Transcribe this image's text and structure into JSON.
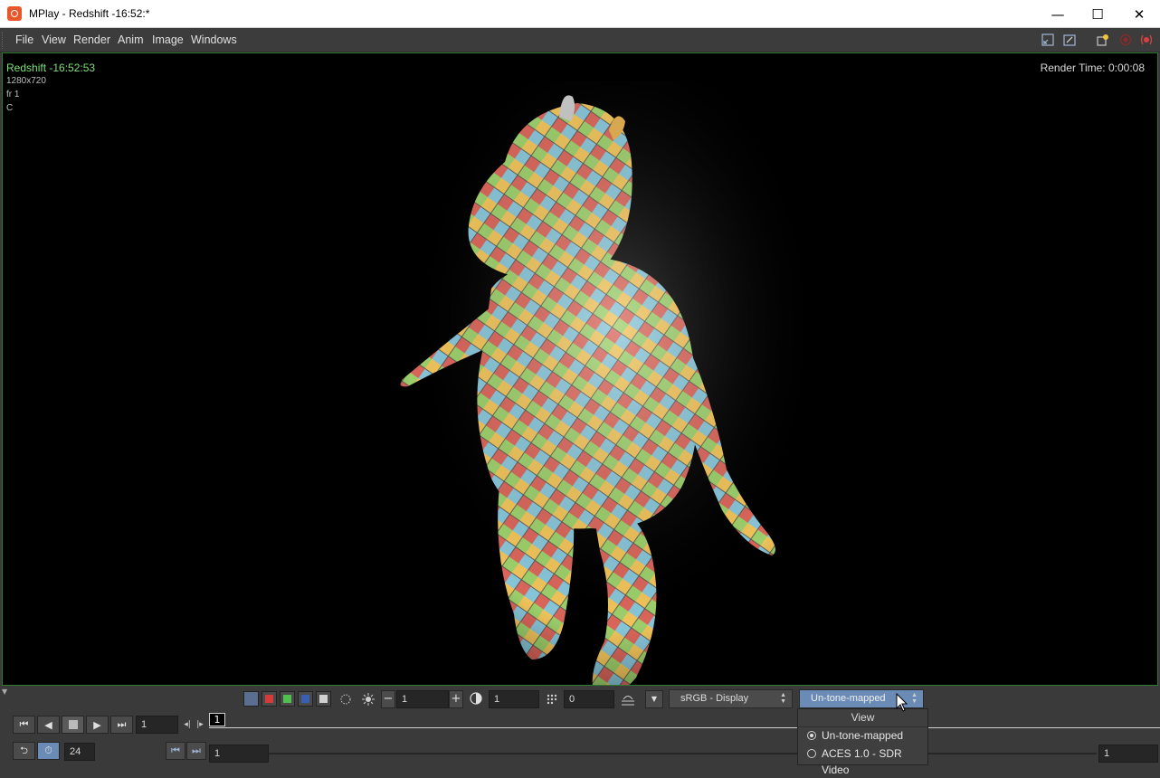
{
  "window": {
    "title": "MPlay - Redshift -16:52:*",
    "minimize_glyph": "—",
    "maximize_glyph": "☐",
    "close_glyph": "✕"
  },
  "menu": {
    "items": [
      "File",
      "View",
      "Render",
      "Anim",
      "Image",
      "Windows"
    ]
  },
  "viewport": {
    "renderer": "Redshift -16:52:53",
    "resolution": "1280x720",
    "frame": "fr 1",
    "plane": "C",
    "render_time": "Render Time: 0:00:08"
  },
  "display": {
    "exposure_value": "1",
    "gamma_value": "1",
    "third_value": "0",
    "colorspace": "sRGB - Display",
    "view": "Un-tone-mapped"
  },
  "dropdown": {
    "header": "View",
    "options": [
      {
        "label": "Un-tone-mapped",
        "selected": true
      },
      {
        "label": "ACES 1.0 - SDR Video",
        "selected": false
      }
    ]
  },
  "playbar": {
    "current_frame": "1",
    "timeline_marker": "1",
    "fps": "24",
    "start_frame": "1",
    "end_frame": "1"
  },
  "colors": {
    "accent_green": "#7fe07a",
    "viewport_border": "#2e7a34",
    "dropdown_highlight": "#6a8bb5"
  },
  "icons": {
    "app": "houdini-icon",
    "mouse": "mouse-cursor-icon"
  }
}
